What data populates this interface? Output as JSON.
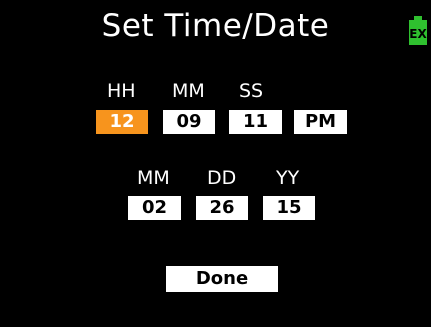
{
  "title": "Set Time/Date",
  "battery": {
    "icon": "battery-ext-icon",
    "label": "EXT",
    "color": "#2fc02f"
  },
  "time": {
    "labels": {
      "hh": "HH",
      "mm": "MM",
      "ss": "SS"
    },
    "values": {
      "hh": "12",
      "mm": "09",
      "ss": "11",
      "ampm": "PM"
    },
    "active_field": "hh"
  },
  "date": {
    "labels": {
      "mm": "MM",
      "dd": "DD",
      "yy": "YY"
    },
    "values": {
      "mm": "02",
      "dd": "26",
      "yy": "15"
    }
  },
  "done_label": "Done",
  "colors": {
    "background": "#000000",
    "active": "#f7941d",
    "field": "#ffffff"
  }
}
